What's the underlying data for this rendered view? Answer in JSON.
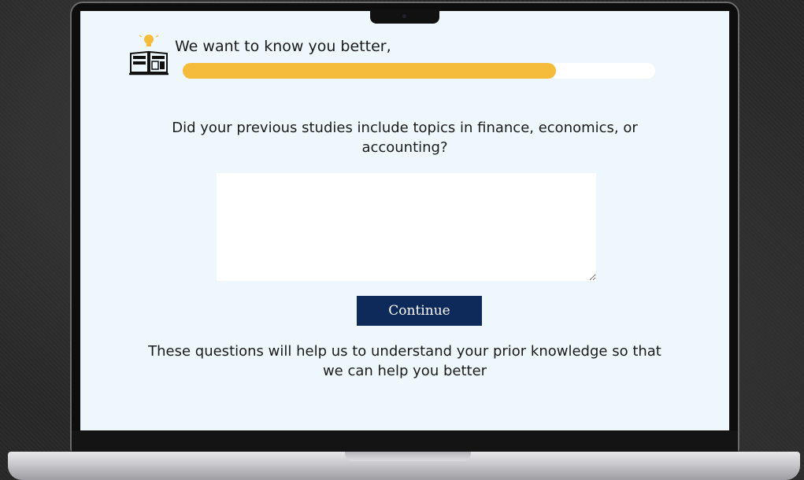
{
  "header": {
    "title": "We want to know you better,",
    "icon": "book-lightbulb-icon",
    "progress_percent": 79
  },
  "question": {
    "text": "Did your previous studies include topics in finance, economics, or accounting?"
  },
  "answer": {
    "value": ""
  },
  "actions": {
    "continue_label": "Continue"
  },
  "footnote": {
    "text": "These questions will help us to understand your prior knowledge so that we can help you better"
  },
  "colors": {
    "accent": "#f5bb3b",
    "button": "#0e2a5a",
    "screen_bg": "#eef8fc"
  }
}
